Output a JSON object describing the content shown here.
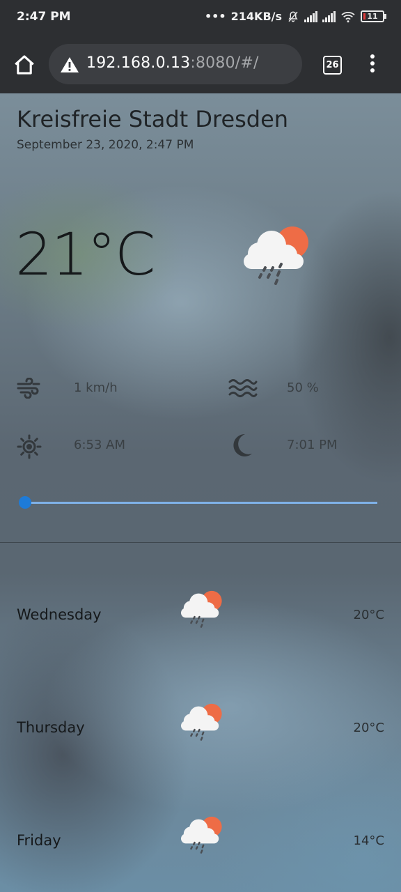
{
  "status_bar": {
    "time": "2:47 PM",
    "net_speed": "214KB/s",
    "battery": "11",
    "icons": [
      "dots-icon",
      "mute-bell-icon",
      "signal-icon",
      "signal-icon",
      "wifi-icon",
      "battery-icon"
    ]
  },
  "browser": {
    "url_host": "192.168.0.13",
    "url_rest": ":8080/#/",
    "tab_count": "26",
    "icons": [
      "home-icon",
      "warning-icon",
      "tabs-icon",
      "more-vert-icon"
    ]
  },
  "weather": {
    "city": "Kreisfreie Stadt Dresden",
    "date": "September 23, 2020, 2:47 PM",
    "temperature": "21°C",
    "condition_icon": "sun-cloud-rain-icon",
    "wind": "1 km/h",
    "humidity": "50 %",
    "sunrise": "6:53 AM",
    "sunset": "7:01 PM",
    "slider_value": 0,
    "colors": {
      "sun": "#ee6c46",
      "cloud": "#f4f4f4",
      "rain": "#4a4e53",
      "slider": "#1e7bd8",
      "slider_track": "#7fb1e8"
    }
  },
  "forecast": [
    {
      "day": "Wednesday",
      "temp": "20°C",
      "icon": "sun-cloud-rain-icon"
    },
    {
      "day": "Thursday",
      "temp": "20°C",
      "icon": "sun-cloud-rain-icon"
    },
    {
      "day": "Friday",
      "temp": "14°C",
      "icon": "sun-cloud-rain-icon"
    }
  ]
}
